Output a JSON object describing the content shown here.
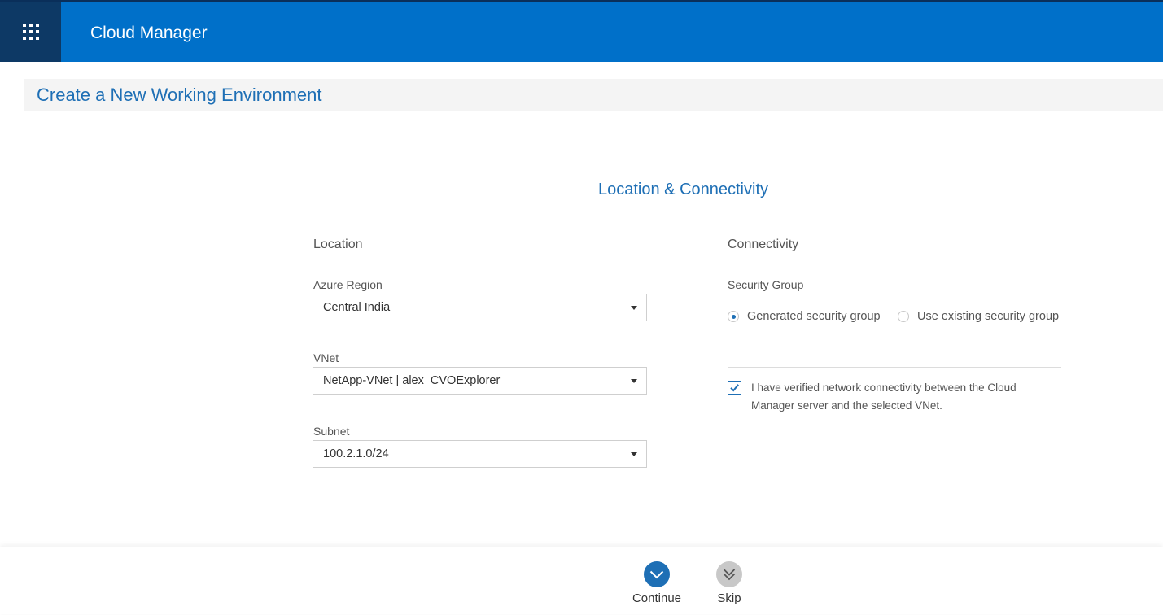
{
  "header": {
    "app_title": "Cloud Manager",
    "launcher_icon": "grid-icon"
  },
  "page": {
    "title": "Create a New Working Environment",
    "section_title": "Location & Connectivity"
  },
  "location": {
    "heading": "Location",
    "azure_region": {
      "label": "Azure Region",
      "value": "Central India"
    },
    "vnet": {
      "label": "VNet",
      "value": "NetApp-VNet | alex_CVOExplorer"
    },
    "subnet": {
      "label": "Subnet",
      "value": "100.2.1.0/24"
    }
  },
  "connectivity": {
    "heading": "Connectivity",
    "security_group_label": "Security Group",
    "options": [
      {
        "label": "Generated security group",
        "selected": true
      },
      {
        "label": "Use existing security group",
        "selected": false
      }
    ],
    "verify_checkbox": {
      "label": "I have verified network connectivity between the Cloud Manager server and the selected VNet.",
      "checked": true
    }
  },
  "footer": {
    "continue_label": "Continue",
    "skip_label": "Skip"
  },
  "colors": {
    "topbar": "#0070c9",
    "launcher_bg": "#0d3965",
    "accent": "#1e6fb5",
    "skip_button": "#c8c8c8"
  }
}
